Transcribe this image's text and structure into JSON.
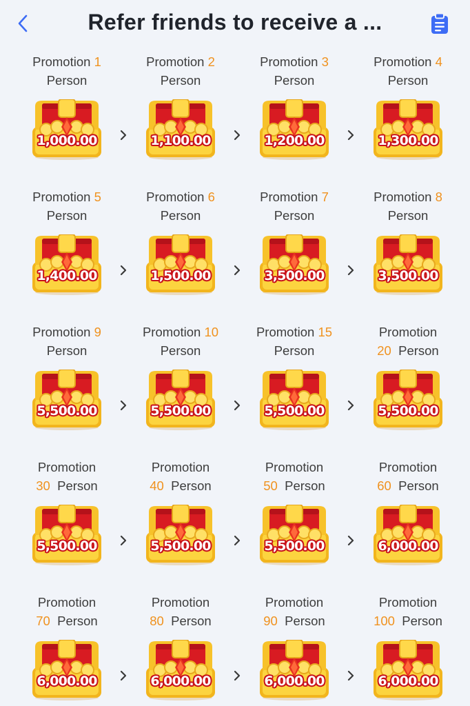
{
  "header": {
    "title": "Refer friends to receive a ..."
  },
  "icons": {
    "back": "chevron-left-icon",
    "clipboard": "clipboard-icon"
  },
  "colors": {
    "accent_number": "#f0921f",
    "icon_blue": "#3d6cf5",
    "chest_red": "#d81b22",
    "chest_gold": "#f7c22a",
    "background": "#f1f4f9"
  },
  "tiers": [
    {
      "word": "Promotion",
      "count": "1",
      "unit": "Person",
      "amount": "1,000.00"
    },
    {
      "word": "Promotion",
      "count": "2",
      "unit": "Person",
      "amount": "1,100.00"
    },
    {
      "word": "Promotion",
      "count": "3",
      "unit": "Person",
      "amount": "1,200.00"
    },
    {
      "word": "Promotion",
      "count": "4",
      "unit": "Person",
      "amount": "1,300.00"
    },
    {
      "word": "Promotion",
      "count": "5",
      "unit": "Person",
      "amount": "1,400.00"
    },
    {
      "word": "Promotion",
      "count": "6",
      "unit": "Person",
      "amount": "1,500.00"
    },
    {
      "word": "Promotion",
      "count": "7",
      "unit": "Person",
      "amount": "3,500.00"
    },
    {
      "word": "Promotion",
      "count": "8",
      "unit": "Person",
      "amount": "3,500.00"
    },
    {
      "word": "Promotion",
      "count": "9",
      "unit": "Person",
      "amount": "5,500.00"
    },
    {
      "word": "Promotion",
      "count": "10",
      "unit": "Person",
      "amount": "5,500.00"
    },
    {
      "word": "Promotion",
      "count": "15",
      "unit": "Person",
      "amount": "5,500.00"
    },
    {
      "word": "Promotion",
      "count": "20",
      "unit": "Person",
      "amount": "5,500.00"
    },
    {
      "word": "Promotion",
      "count": "30",
      "unit": "Person",
      "amount": "5,500.00"
    },
    {
      "word": "Promotion",
      "count": "40",
      "unit": "Person",
      "amount": "5,500.00"
    },
    {
      "word": "Promotion",
      "count": "50",
      "unit": "Person",
      "amount": "5,500.00"
    },
    {
      "word": "Promotion",
      "count": "60",
      "unit": "Person",
      "amount": "6,000.00"
    },
    {
      "word": "Promotion",
      "count": "70",
      "unit": "Person",
      "amount": "6,000.00"
    },
    {
      "word": "Promotion",
      "count": "80",
      "unit": "Person",
      "amount": "6,000.00"
    },
    {
      "word": "Promotion",
      "count": "90",
      "unit": "Person",
      "amount": "6,000.00"
    },
    {
      "word": "Promotion",
      "count": "100",
      "unit": "Person",
      "amount": "6,000.00"
    }
  ]
}
